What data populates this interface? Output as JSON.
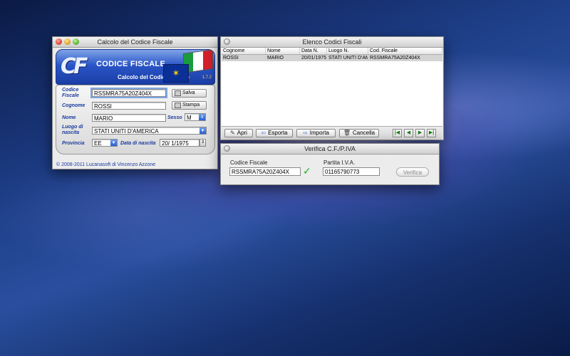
{
  "calc_window": {
    "title": "Calcolo del Codice Fiscale",
    "logo_text": "CF",
    "banner_title": "CODICE FISCALE",
    "banner_subtitle": "Calcolo del Codice Fiscale",
    "version": "1.7.2",
    "labels": {
      "codice_fiscale": "Codice Fiscale",
      "cognome": "Cognome",
      "nome": "Nome",
      "sesso": "Sesso",
      "luogo_nascita": "Luogo di nascita",
      "provincia": "Provincia",
      "data_nascita": "Data di nascita"
    },
    "values": {
      "codice_fiscale": "RSSMRA75A20Z404X",
      "cognome": "ROSSI",
      "nome": "MARIO",
      "sesso": "M",
      "luogo_nascita": "STATI UNITI D'AMERICA",
      "provincia": "EE",
      "data_nascita": "20/  1/1975"
    },
    "buttons": {
      "salva": "Salva",
      "stampa": "Stampa"
    },
    "copyright": "© 2008-2011 Lucanasoft di Vincenzo Azzone",
    "flag_colors": [
      "#1a9b3c",
      "#ffffff",
      "#d6202a"
    ]
  },
  "list_window": {
    "title": "Elenco Codici Fiscali",
    "columns": [
      "Cognome",
      "Nome",
      "Data N.",
      "Luogo N.",
      "Cod. Fiscale"
    ],
    "rows": [
      [
        "ROSSI",
        "MARIO",
        "20/01/1975",
        "STATI UNITI D'AMERICA",
        "RSSMRA75A20Z404X"
      ]
    ],
    "buttons": {
      "apri": "Apri",
      "esporta": "Esporta",
      "importa": "Importa",
      "cancella": "Cancella"
    },
    "nav": [
      "first",
      "prev",
      "next",
      "last"
    ]
  },
  "verify_window": {
    "title": "Verifica C.F./P.IVA",
    "cf_label": "Codice Fiscale",
    "cf_value": "RSSMRA75A20Z404X",
    "piva_label": "Partita I.V.A.",
    "piva_value": "01165790773",
    "button": "Verifica"
  }
}
